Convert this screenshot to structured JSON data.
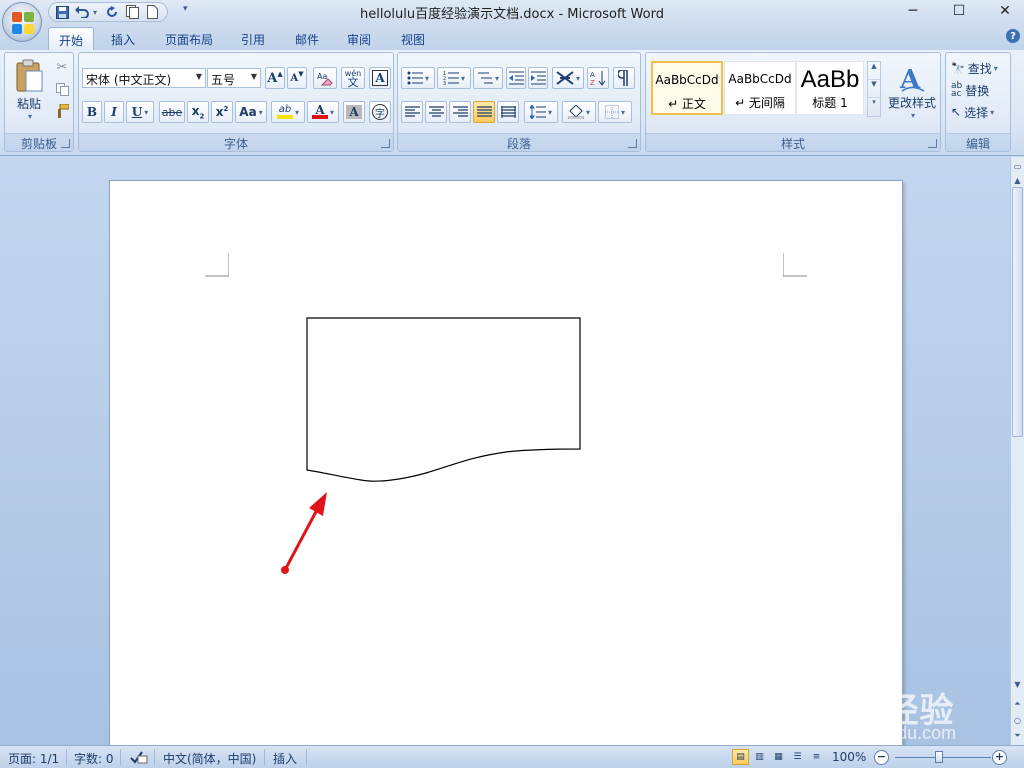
{
  "window": {
    "title": "hellolulu百度经验演示文档.docx - Microsoft Word",
    "controls": [
      "─",
      "☐",
      "✕"
    ]
  },
  "quick_access": {
    "save_icon": "save-icon",
    "undo_icon": "undo-icon",
    "redo_icon": "redo-icon"
  },
  "tabs": [
    {
      "label": "开始",
      "active": true
    },
    {
      "label": "插入"
    },
    {
      "label": "页面布局"
    },
    {
      "label": "引用"
    },
    {
      "label": "邮件"
    },
    {
      "label": "审阅"
    },
    {
      "label": "视图"
    }
  ],
  "ribbon": {
    "clipboard": {
      "label": "剪贴板",
      "paste": "粘贴"
    },
    "font": {
      "label": "字体",
      "font_name": "宋体 (中文正文)",
      "font_size": "五号",
      "grow": "A",
      "shrink": "A",
      "phonetic_top": "wén",
      "phonetic_bottom": "文",
      "border_char": "A",
      "bold": "B",
      "italic": "I",
      "underline": "U",
      "strike": "abe",
      "sub": "x",
      "sub_mark": "2",
      "sup": "x",
      "sup_mark": "2",
      "case": "Aa",
      "highlight": "ab",
      "color": "A",
      "shade": "A",
      "enclose": "字",
      "highlight_color": "#f5e400",
      "font_color": "#e01010"
    },
    "paragraph": {
      "label": "段落"
    },
    "styles": {
      "label": "样式",
      "items": [
        {
          "sample": "AaBbCcDd",
          "name": "↵ 正文"
        },
        {
          "sample": "AaBbCcDd",
          "name": "↵ 无间隔"
        },
        {
          "sample": "AaBb",
          "name": "标题 1"
        }
      ],
      "change": "更改样式"
    },
    "editing": {
      "label": "编辑",
      "find": "查找",
      "replace": "替换",
      "select": "选择"
    }
  },
  "help": "?",
  "statusbar": {
    "page": "页面: 1/1",
    "words": "字数: 0",
    "language": "中文(简体，中国)",
    "mode": "插入",
    "zoom": "100%"
  },
  "watermark": {
    "brand": "Baidu经验",
    "url": "jingyan.baidu.com"
  }
}
